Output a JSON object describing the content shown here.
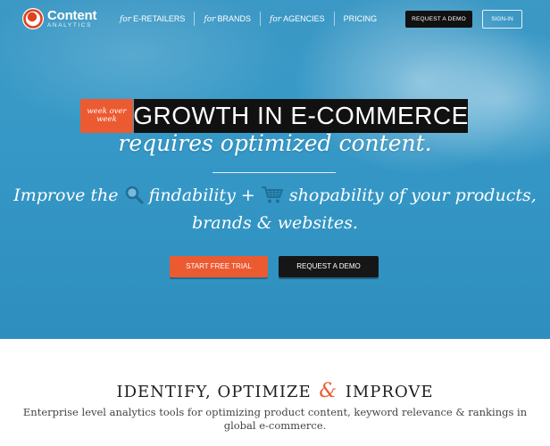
{
  "brand": {
    "name": "Content",
    "subtitle": "ANALYTICS",
    "mark_color": "#e0421e"
  },
  "nav": {
    "items": [
      {
        "prefix": "for",
        "label": "E-RETAILERS"
      },
      {
        "prefix": "for",
        "label": "BRANDS"
      },
      {
        "prefix": "for",
        "label": "AGENCIES"
      },
      {
        "prefix": "",
        "label": "PRICING"
      }
    ],
    "request_demo": "REQUEST A DEMO",
    "sign_in": "SIGN-IN"
  },
  "hero": {
    "badge_line1": "week over",
    "badge_line2": "week",
    "headline": "GROWTH IN E-COMMERCE",
    "subhead": "requires optimized content.",
    "tagline_part1": "Improve the",
    "tagline_part2": "findability +",
    "tagline_part3": "shopability of your products,",
    "tagline_line2": "brands & websites.",
    "search_icon": "magnifier-icon",
    "cart_icon": "shopping-cart-icon",
    "cta_trial": "START FREE TRIAL",
    "cta_demo": "REQUEST A DEMO"
  },
  "features": {
    "title_part1": "IDENTIFY, OPTIMIZE",
    "title_amp": "&",
    "title_part2": "IMPROVE",
    "description": "Enterprise level analytics tools for optimizing product content, keyword relevance & rankings in global e-commerce."
  },
  "colors": {
    "accent": "#ec5a31",
    "hero_blue": "#3698c6",
    "dark": "#111111"
  }
}
